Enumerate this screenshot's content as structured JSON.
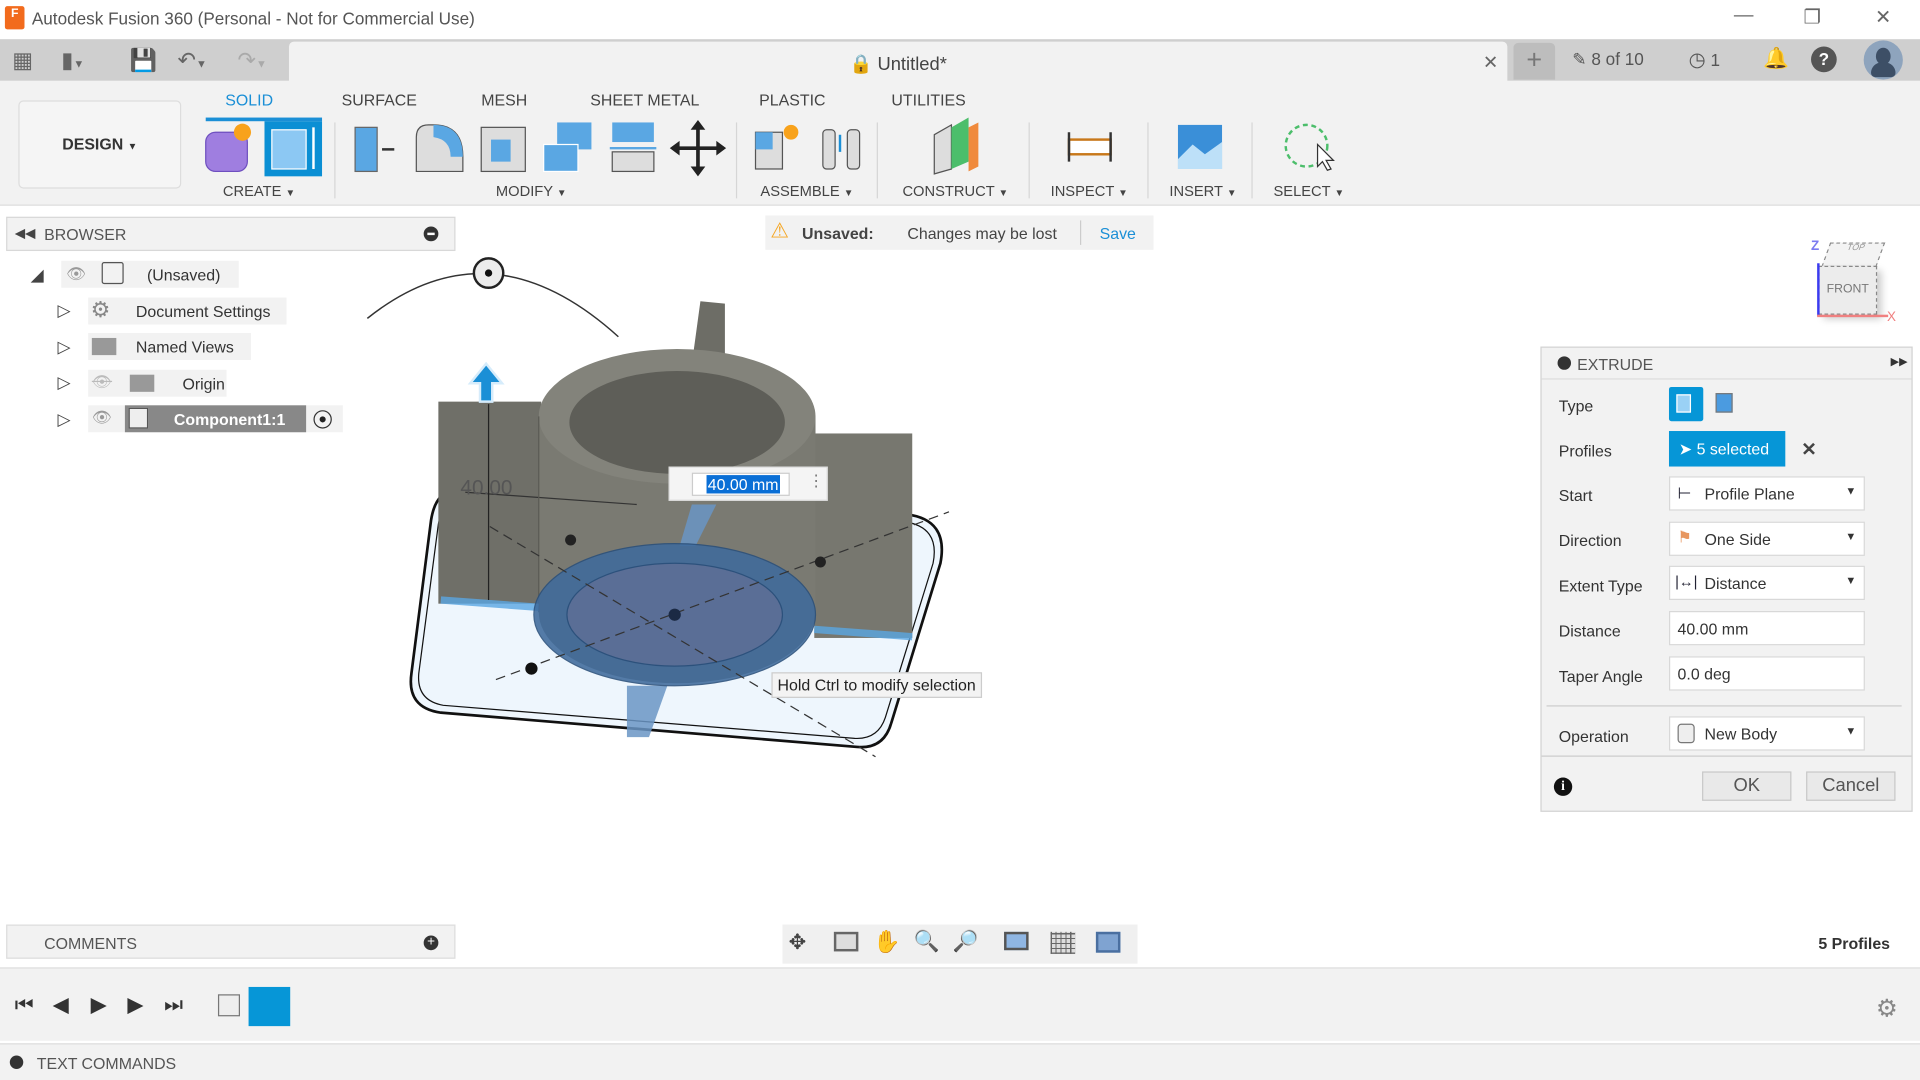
{
  "app": {
    "title": "Autodesk Fusion 360 (Personal - Not for Commercial Use)",
    "logo_letter": "F"
  },
  "document": {
    "title": "Untitled*",
    "file_count": "8 of 10",
    "jobs_count": "1"
  },
  "ribbon": {
    "workspace": "DESIGN",
    "tabs": [
      "SOLID",
      "SURFACE",
      "MESH",
      "SHEET METAL",
      "PLASTIC",
      "UTILITIES"
    ],
    "active_tab": "SOLID",
    "groups": [
      "CREATE",
      "MODIFY",
      "ASSEMBLE",
      "CONSTRUCT",
      "INSPECT",
      "INSERT",
      "SELECT"
    ]
  },
  "browser": {
    "title": "BROWSER",
    "root": "(Unsaved)",
    "items": [
      "Document Settings",
      "Named Views",
      "Origin",
      "Component1:1"
    ]
  },
  "unsaved_bar": {
    "label": "Unsaved:",
    "message": "Changes may be lost",
    "save": "Save"
  },
  "viewcube": {
    "top": "TOP",
    "front": "FRONT",
    "z": "Z",
    "x": "X"
  },
  "canvas": {
    "dimension_label": "40.00",
    "distance_input": "40.00 mm",
    "tooltip": "Hold Ctrl to modify selection"
  },
  "extrude": {
    "title": "EXTRUDE",
    "labels": {
      "type": "Type",
      "profiles": "Profiles",
      "start": "Start",
      "direction": "Direction",
      "extent_type": "Extent Type",
      "distance": "Distance",
      "taper_angle": "Taper Angle",
      "operation": "Operation"
    },
    "profiles_value": "5 selected",
    "start_value": "Profile Plane",
    "direction_value": "One Side",
    "extent_value": "Distance",
    "distance_value": "40.00 mm",
    "taper_value": "0.0 deg",
    "operation_value": "New Body",
    "ok": "OK",
    "cancel": "Cancel"
  },
  "comments": {
    "title": "COMMENTS"
  },
  "status": {
    "profiles": "5 Profiles"
  },
  "text_commands": {
    "title": "TEXT COMMANDS"
  },
  "colors": {
    "accent": "#0696d7",
    "selection": "#5a8fc4",
    "model": "#7b7b73"
  }
}
